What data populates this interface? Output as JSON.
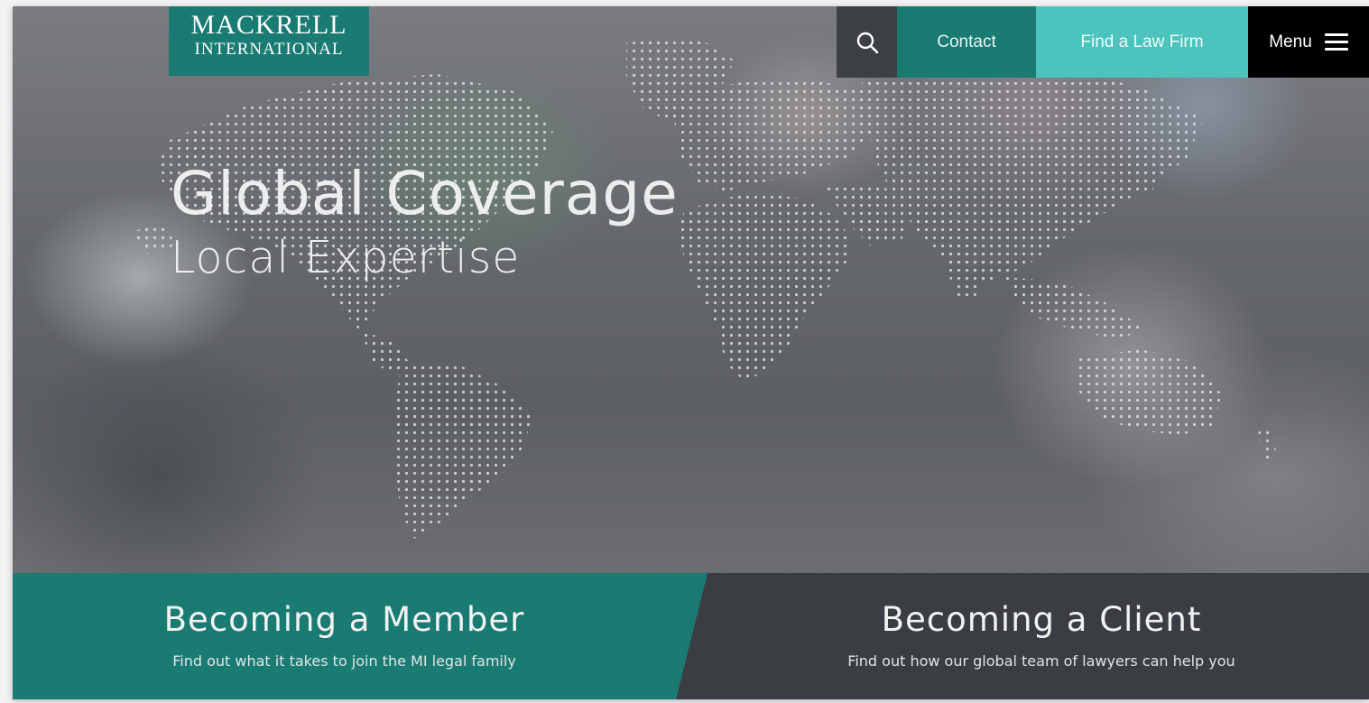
{
  "logo": {
    "line1": "MACKRELL",
    "line2": "INTERNATIONAL"
  },
  "nav": {
    "search_icon": "search-icon",
    "contact_label": "Contact",
    "find_label": "Find a Law Firm",
    "menu_label": "Menu",
    "menu_icon": "hamburger-icon"
  },
  "hero": {
    "title": "Global Coverage",
    "subtitle": "Local Expertise"
  },
  "cards": {
    "member": {
      "title": "Becoming a Member",
      "subtitle": "Find out what it takes to join the MI legal family"
    },
    "client": {
      "title": "Becoming a Client",
      "subtitle": "Find out how our global team of lawyers can help you"
    }
  },
  "colors": {
    "teal": "#1a7b73",
    "light_teal": "#4cc3bd",
    "dark_gray": "#3a3d42",
    "black": "#000000"
  }
}
